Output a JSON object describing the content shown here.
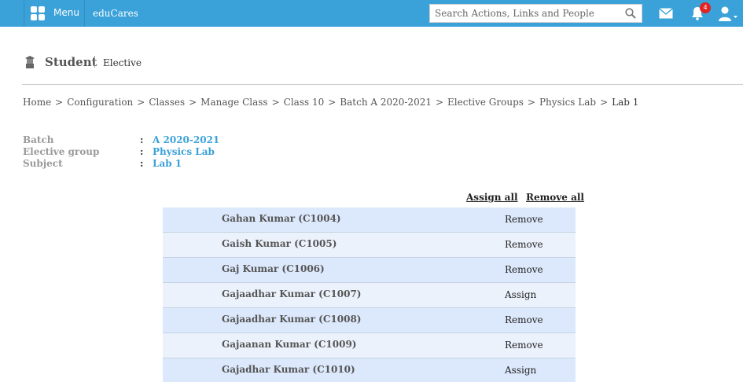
{
  "topbar": {
    "menu_label": "Menu",
    "app_name": "eduCares",
    "search_placeholder": "Search Actions, Links and People",
    "notification_count": "4",
    "colors": {
      "bar": "#3aa1d9",
      "badge": "#e02424"
    }
  },
  "header": {
    "title": "Student",
    "subtitle": "Elective"
  },
  "breadcrumb": [
    "Home",
    "Configuration",
    "Classes",
    "Manage Class",
    "Class 10",
    "Batch A 2020-2021",
    "Elective Groups",
    "Physics Lab",
    "Lab 1"
  ],
  "breadcrumb_separator": ">",
  "info": {
    "colon": ":",
    "rows": [
      {
        "label": "Batch",
        "value": "A 2020-2021"
      },
      {
        "label": "Elective group",
        "value": "Physics Lab"
      },
      {
        "label": "Subject",
        "value": "Lab 1"
      }
    ]
  },
  "actions": {
    "assign_all": "Assign all",
    "remove_all": "Remove all"
  },
  "students": [
    {
      "name": "Gahan Kumar (C1004)",
      "action": "Remove"
    },
    {
      "name": "Gaish Kumar (C1005)",
      "action": "Remove"
    },
    {
      "name": "Gaj Kumar (C1006)",
      "action": "Remove"
    },
    {
      "name": "Gajaadhar Kumar (C1007)",
      "action": "Assign"
    },
    {
      "name": "Gajaadhar Kumar (C1008)",
      "action": "Remove"
    },
    {
      "name": "Gajaanan Kumar (C1009)",
      "action": "Remove"
    },
    {
      "name": "Gajadhar Kumar (C1010)",
      "action": "Assign"
    }
  ]
}
